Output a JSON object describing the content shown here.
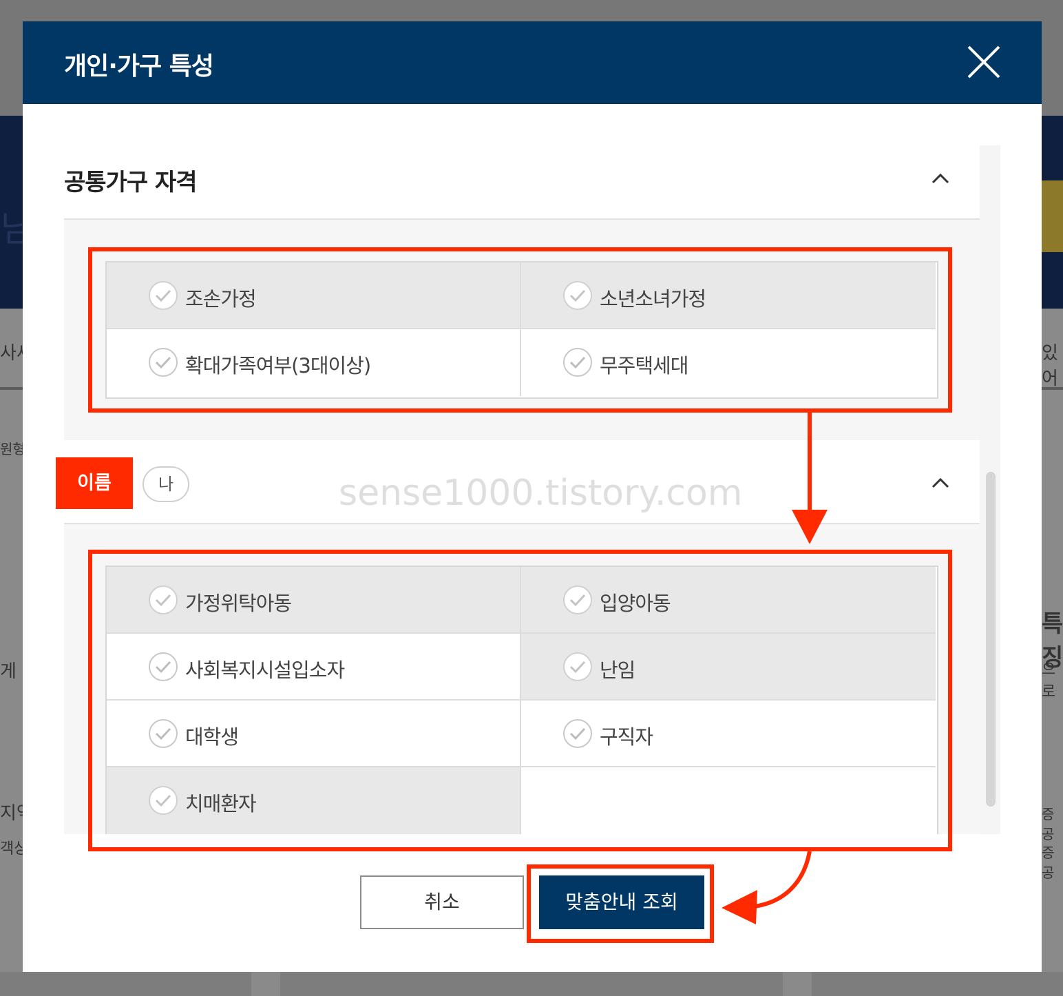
{
  "background": {
    "fragments": [
      "님",
      "사세",
      "원형",
      "게",
      "지역",
      "객상",
      "있어",
      "특징",
      "으로",
      "증공",
      "증공"
    ]
  },
  "modal": {
    "title": "개인·가구 특성",
    "close_icon": "close-icon"
  },
  "section1": {
    "title": "공통가구 자격",
    "items": [
      {
        "label": "조손가정",
        "checked": false
      },
      {
        "label": "소년소녀가정",
        "checked": false
      },
      {
        "label": "확대가족여부(3대이상)",
        "checked": false
      },
      {
        "label": "무주택세대",
        "checked": false
      }
    ]
  },
  "section2": {
    "badge": "이름",
    "badge_suffix": "나",
    "items": [
      {
        "label": "가정위탁아동",
        "checked": false
      },
      {
        "label": "입양아동",
        "checked": false
      },
      {
        "label": "사회복지시설입소자",
        "checked": false
      },
      {
        "label": "난임",
        "checked": false
      },
      {
        "label": "대학생",
        "checked": false
      },
      {
        "label": "구직자",
        "checked": false
      },
      {
        "label": "치매환자",
        "checked": false
      }
    ]
  },
  "watermark": "sense1000.tistory.com",
  "buttons": {
    "cancel": "취소",
    "search": "맞춤안내 조회"
  },
  "colors": {
    "header": "#003764",
    "highlight": "#ff2a00",
    "cell_grey": "#e8e8e9"
  }
}
